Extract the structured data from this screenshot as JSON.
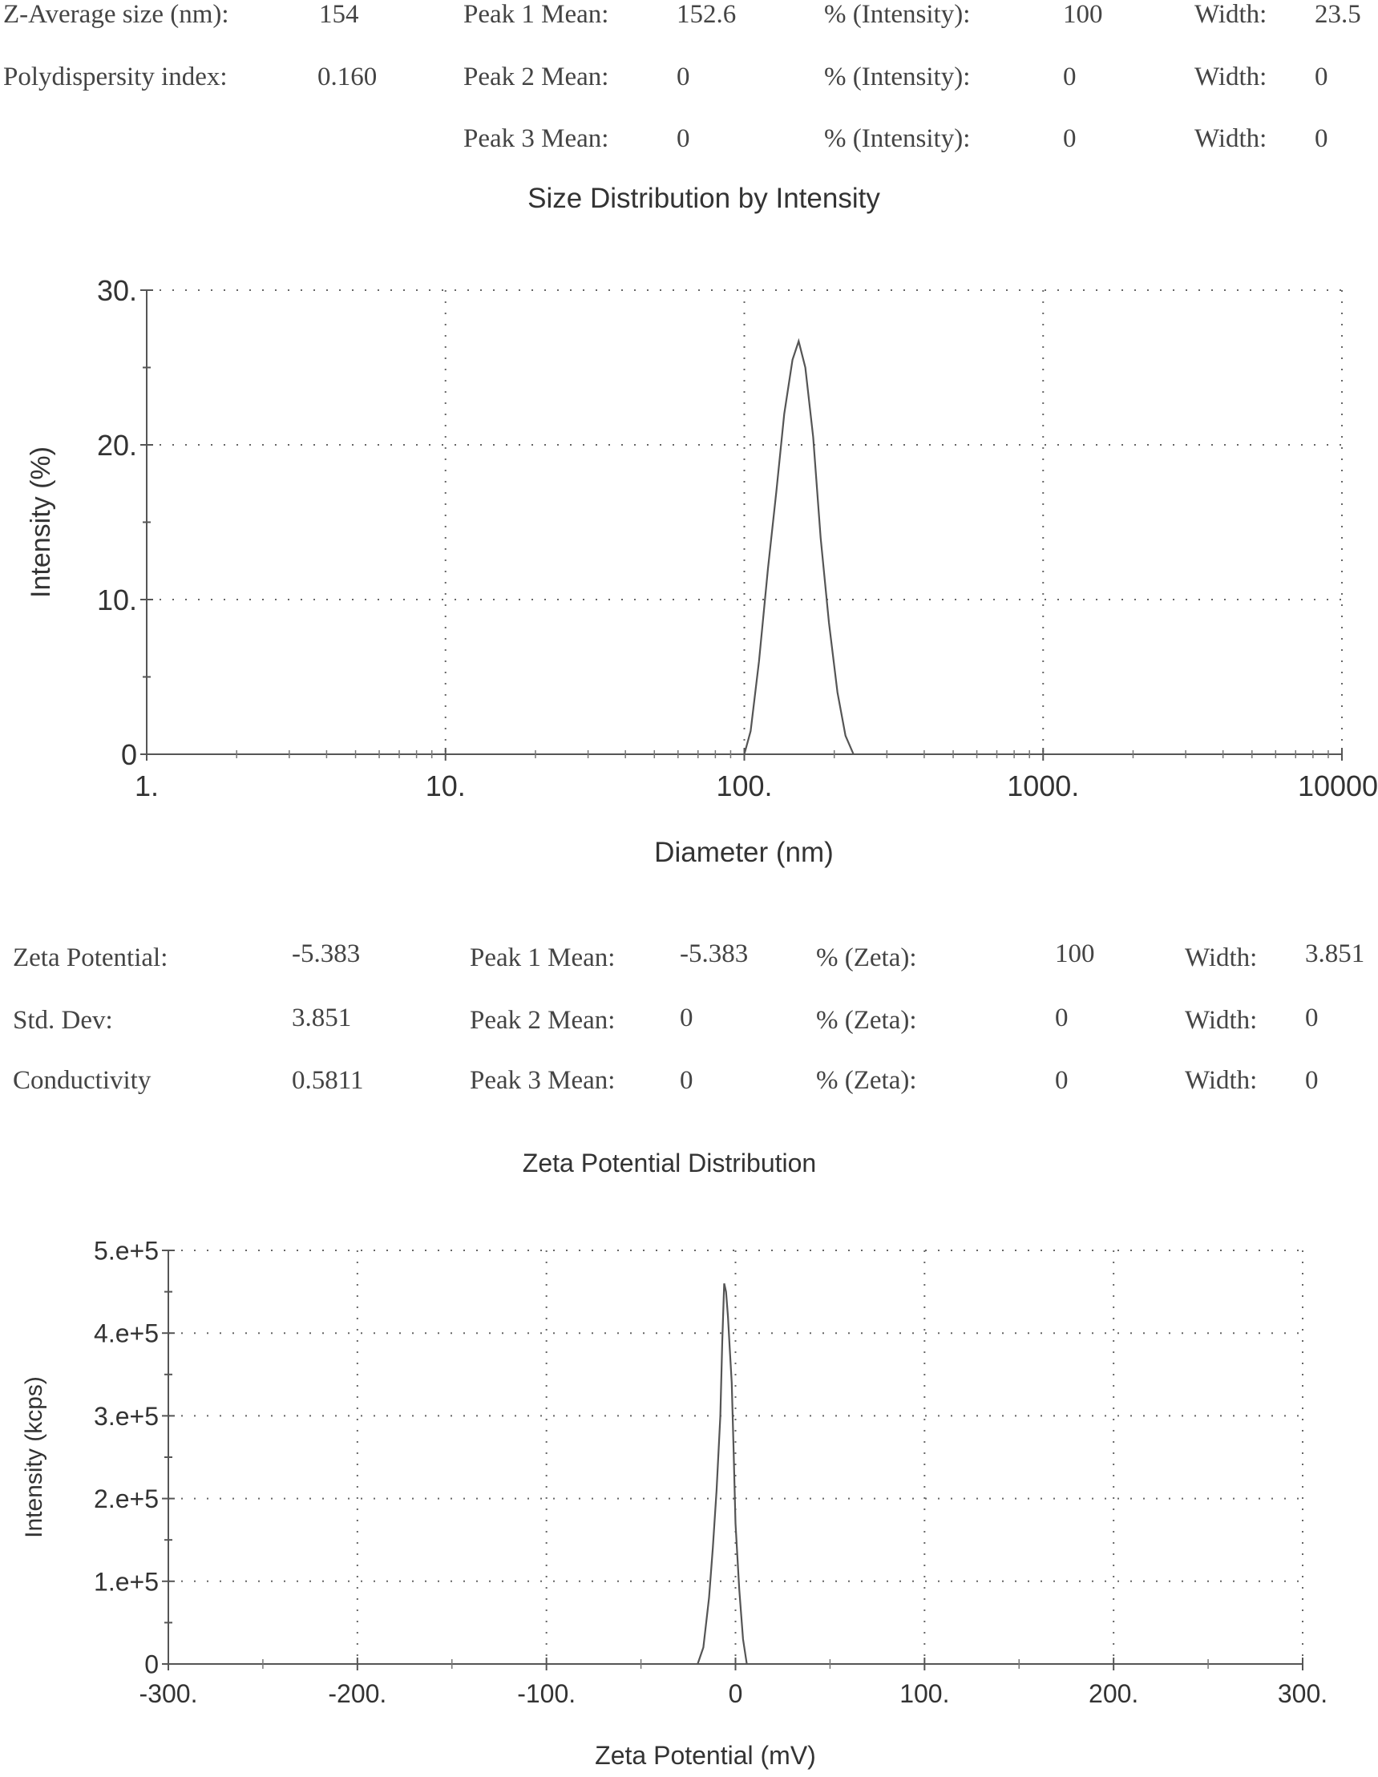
{
  "size_summary": {
    "rows": [
      {
        "label": "Z-Average size (nm):",
        "value": "154",
        "peak_label": "Peak 1 Mean:",
        "peak_value": "152.6",
        "pct_label": "% (Intensity):",
        "pct_value": "100",
        "width_label": "Width:",
        "width_value": "23.5"
      },
      {
        "label": "Polydispersity index:",
        "value": "0.160",
        "peak_label": "Peak 2 Mean:",
        "peak_value": "0",
        "pct_label": "% (Intensity):",
        "pct_value": "0",
        "width_label": "Width:",
        "width_value": "0"
      },
      {
        "label": "",
        "value": "",
        "peak_label": "Peak 3 Mean:",
        "peak_value": "0",
        "pct_label": "% (Intensity):",
        "pct_value": "0",
        "width_label": "Width:",
        "width_value": "0"
      }
    ]
  },
  "zeta_summary": {
    "rows": [
      {
        "label": "Zeta Potential:",
        "value": "-5.383",
        "peak_label": "Peak 1 Mean:",
        "peak_value": "-5.383",
        "pct_label": "% (Zeta):",
        "pct_value": "100",
        "width_label": "Width:",
        "width_value": "3.851"
      },
      {
        "label": "Std. Dev:",
        "value": "3.851",
        "peak_label": "Peak 2 Mean:",
        "peak_value": "0",
        "pct_label": "% (Zeta):",
        "pct_value": "0",
        "width_label": "Width:",
        "width_value": "0"
      },
      {
        "label": "Conductivity",
        "value": "0.5811",
        "peak_label": "Peak 3 Mean:",
        "peak_value": "0",
        "pct_label": "% (Zeta):",
        "pct_value": "0",
        "width_label": "Width:",
        "width_value": "0"
      }
    ]
  },
  "chart_data": [
    {
      "type": "line",
      "title": "Size Distribution by Intensity",
      "xlabel": "Diameter (nm)",
      "ylabel": "Intensity (%)",
      "xscale": "log",
      "xlim": [
        1,
        10000
      ],
      "ylim": [
        0,
        30
      ],
      "x_ticks": [
        1,
        10,
        100,
        1000,
        10000
      ],
      "x_tick_labels": [
        "1.",
        "10.",
        "100.",
        "1000.",
        "10000."
      ],
      "y_ticks": [
        0,
        10,
        20,
        30
      ],
      "y_tick_labels": [
        "0",
        "10.",
        "20.",
        "30."
      ],
      "grid": true,
      "grid_style": "dotted",
      "series": [
        {
          "name": "Intensity",
          "x": [
            100,
            105,
            112,
            120,
            128,
            136,
            145,
            152,
            160,
            170,
            180,
            192,
            205,
            218,
            232
          ],
          "y": [
            0,
            1.5,
            6,
            12,
            17,
            22,
            25.5,
            26.7,
            25,
            20.5,
            14,
            8.5,
            4,
            1.2,
            0
          ]
        }
      ]
    },
    {
      "type": "line",
      "title": "Zeta Potential Distribution",
      "xlabel": "Zeta Potential (mV)",
      "ylabel": "Intensity (kcps)",
      "xlim": [
        -300,
        300
      ],
      "ylim": [
        0,
        500000
      ],
      "x_ticks": [
        -300,
        -200,
        -100,
        0,
        100,
        200,
        300
      ],
      "x_tick_labels": [
        "-300.",
        "-200.",
        "-100.",
        "0",
        "100.",
        "200.",
        "300."
      ],
      "y_ticks": [
        0,
        100000,
        200000,
        300000,
        400000,
        500000
      ],
      "y_tick_labels": [
        "0",
        "1.e+5",
        "2.e+5",
        "3.e+5",
        "4.e+5",
        "5.e+5"
      ],
      "grid": true,
      "grid_style": "dotted",
      "series": [
        {
          "name": "Intensity",
          "x": [
            -20,
            -17,
            -14,
            -12,
            -10,
            -8,
            -7,
            -6,
            -5,
            -4,
            -3,
            -2,
            -1,
            0,
            2,
            4,
            6
          ],
          "y": [
            0,
            20000,
            80000,
            140000,
            210000,
            300000,
            390000,
            460000,
            450000,
            420000,
            380000,
            340000,
            260000,
            170000,
            90000,
            30000,
            0
          ]
        }
      ]
    }
  ]
}
